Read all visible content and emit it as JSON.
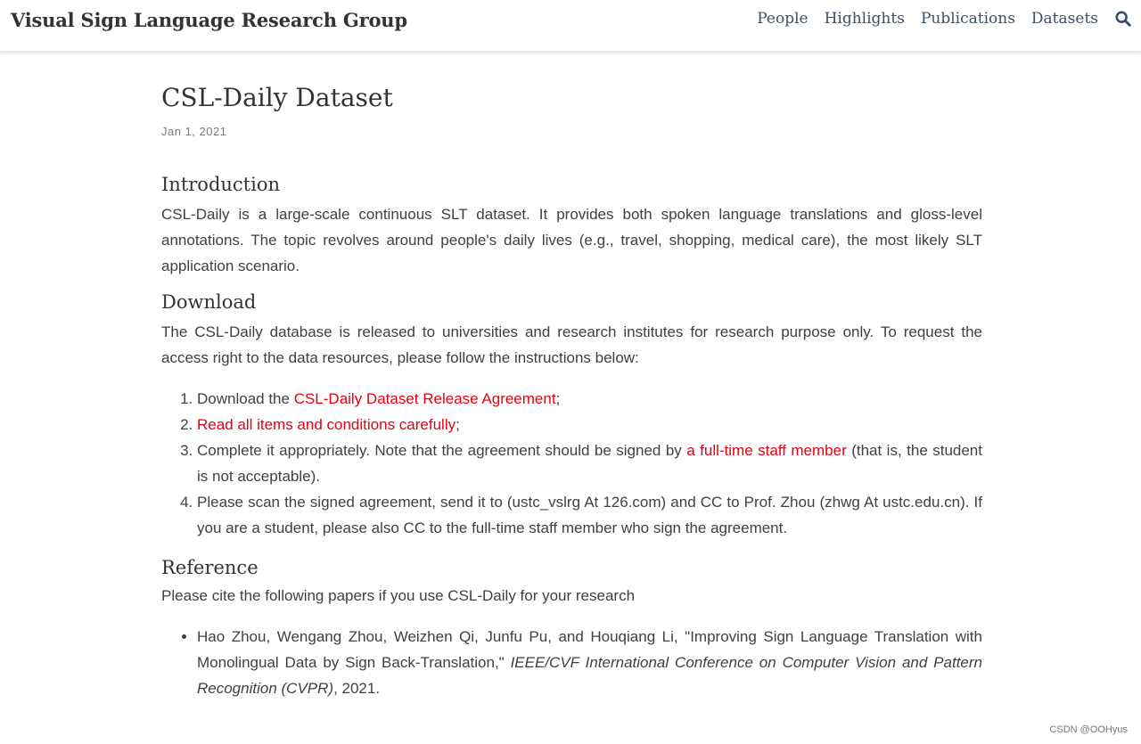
{
  "nav": {
    "brand": "Visual Sign Language Research Group",
    "links": [
      "People",
      "Highlights",
      "Publications",
      "Datasets"
    ],
    "search_icon": "search-icon"
  },
  "post": {
    "title": "CSL-Daily Dataset",
    "date": "Jan 1, 2021"
  },
  "introduction": {
    "heading": "Introduction",
    "text": "CSL-Daily is a large-scale continuous SLT dataset. It provides both spoken language translations and gloss-level annotations. The topic revolves around people's daily lives (e.g., travel, shopping, medical care), the most likely SLT application scenario."
  },
  "download": {
    "heading": "Download",
    "text": "The CSL-Daily database is released to universities and research institutes for research purpose only. To request the access right to the data resources, please follow the instructions below:",
    "steps": [
      {
        "before": "Download the ",
        "link": "CSL-Daily Dataset Release Agreement",
        "after": ";"
      },
      {
        "before": "",
        "link": "Read all items and conditions carefully",
        "after": ";"
      },
      {
        "before": "Complete it appropriately. Note that the agreement should be signed by ",
        "link": "a full-time staff member",
        "after": " (that is, the student is not acceptable)."
      },
      {
        "before": "Please scan the signed agreement, send it to (ustc_vslrg At 126.com) and CC to Prof. Zhou (zhwg At ustc.edu.cn). If you are a student, please also CC to the full-time staff member who sign the agreement.",
        "link": "",
        "after": ""
      }
    ]
  },
  "reference": {
    "heading": "Reference",
    "text": "Please cite the following papers if you use CSL-Daily for your research",
    "citations": [
      {
        "authors": "Hao Zhou, Wengang Zhou, Weizhen Qi, Junfu Pu, and Houqiang Li, \"Improving Sign Language Translation with Monolingual Data by Sign Back-Translation,\" ",
        "venue": "IEEE/CVF International Conference on Computer Vision and Pattern Recognition (CVPR)",
        "year": ", 2021."
      }
    ]
  },
  "watermark": "CSDN @OOHyus",
  "colors": {
    "link_red": "#e60012",
    "nav_text": "#3a5068",
    "body_text": "#404040"
  }
}
